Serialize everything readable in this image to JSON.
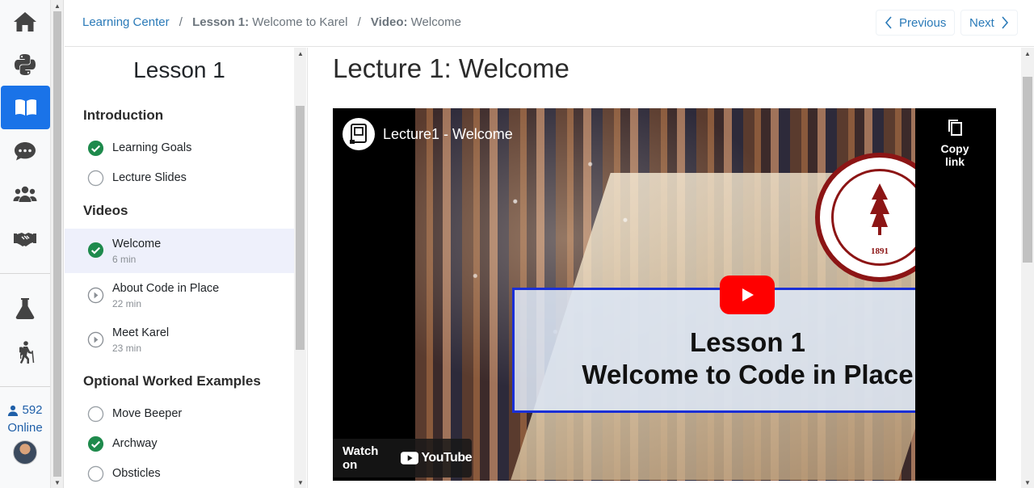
{
  "rail": {
    "icons": [
      "home-icon",
      "python-icon",
      "book-icon",
      "chat-icon",
      "group-icon",
      "handshake-icon",
      "flask-icon",
      "hiker-icon"
    ],
    "online_count": "592",
    "online_label": "Online"
  },
  "breadcrumb": {
    "root": "Learning Center",
    "lesson_prefix": "Lesson 1:",
    "lesson_name": "Welcome to Karel",
    "video_prefix": "Video:",
    "video_name": "Welcome"
  },
  "nav": {
    "previous": "Previous",
    "next": "Next"
  },
  "lesson": {
    "title": "Lesson 1",
    "sections": [
      {
        "heading": "Introduction",
        "items": [
          {
            "label": "Learning Goals",
            "status": "done"
          },
          {
            "label": "Lecture Slides",
            "status": "todo"
          }
        ]
      },
      {
        "heading": "Videos",
        "items": [
          {
            "label": "Welcome",
            "duration": "6 min",
            "status": "done",
            "active": true
          },
          {
            "label": "About Code in Place",
            "duration": "22 min",
            "status": "video"
          },
          {
            "label": "Meet Karel",
            "duration": "23 min",
            "status": "video"
          }
        ]
      },
      {
        "heading": "Optional Worked Examples",
        "items": [
          {
            "label": "Move Beeper",
            "status": "todo"
          },
          {
            "label": "Archway",
            "status": "done"
          },
          {
            "label": "Obsticles",
            "status": "todo"
          }
        ]
      }
    ]
  },
  "main": {
    "title": "Lecture 1: Welcome",
    "video": {
      "video_title": "Lecture1 - Welcome",
      "copy_link": "Copy link",
      "slide_line1": "Lesson 1",
      "slide_line2": "Welcome to Code in Place",
      "seal_year": "1891",
      "watch_on": "Watch on",
      "youtube": "YouTube"
    }
  },
  "colors": {
    "accent": "#1a73e8",
    "link": "#2a7ab8",
    "done_green": "#1e8a4c",
    "active_row": "#eef0fb",
    "stanford_red": "#8c1515"
  }
}
